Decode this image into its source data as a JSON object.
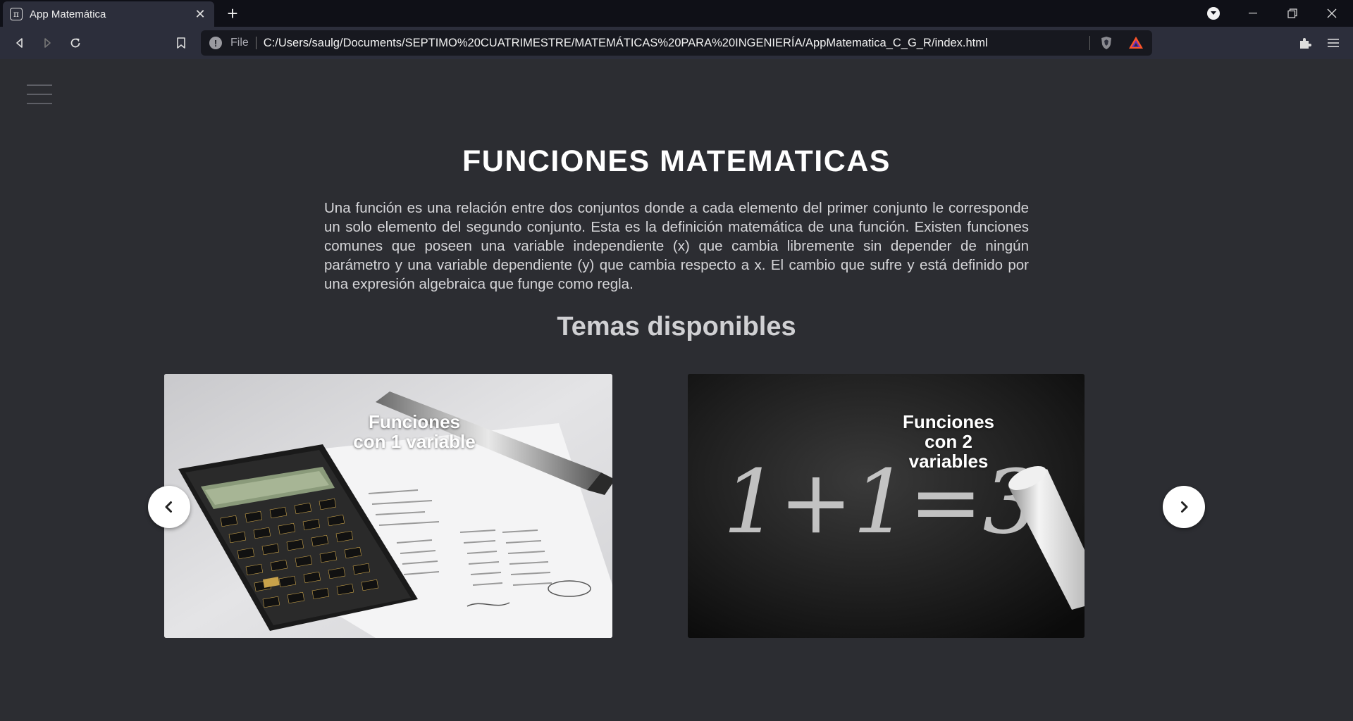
{
  "browser": {
    "tab_title": "App Matemática",
    "tab_favicon": "π",
    "url_scheme": "File",
    "url": "C:/Users/saulg/Documents/SEPTIMO%20CUATRIMESTRE/MATEMÁTICAS%20PARA%20INGENIERÍA/AppMatematica_C_G_R/index.html"
  },
  "page": {
    "title": "FUNCIONES MATEMATICAS",
    "intro": "Una función es una relación entre dos conjuntos donde a cada elemento del primer conjunto le corresponde un solo elemento del segundo conjunto. Esta es la definición matemática de una función. Existen funciones comunes que poseen una variable independiente (x) que cambia libremente sin depender de ningún parámetro y una variable dependiente (y) que cambia respecto a x. El cambio que sufre y está definido por una expresión algebraica que funge como regla.",
    "subtitle": "Temas disponibles"
  },
  "cards": [
    {
      "label_line1": "Funciones",
      "label_line2": "con 1 variable"
    },
    {
      "label_line1": "Funciones",
      "label_line2": "con 2",
      "label_line3": "variables",
      "chalk_text": "1+1=3"
    }
  ],
  "colors": {
    "page_bg": "#2c2d32",
    "tabbar_bg": "#0f1017",
    "toolbar_bg": "#2c2e3b",
    "brave_orange": "#fb542b"
  }
}
